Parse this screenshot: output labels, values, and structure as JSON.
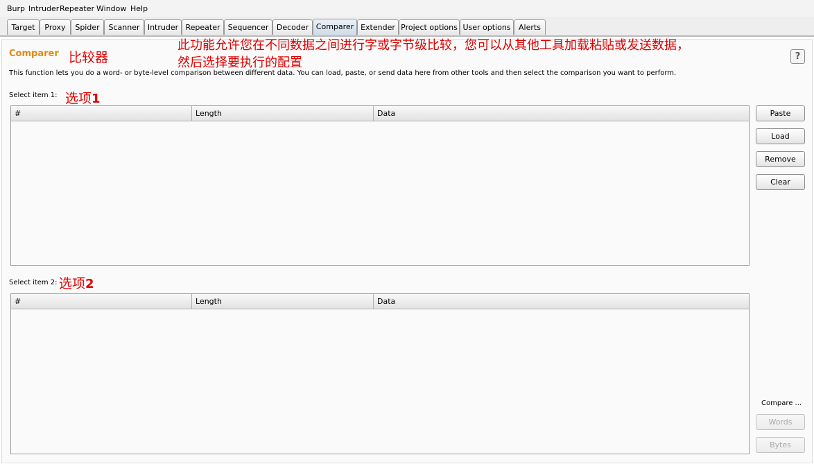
{
  "menu": [
    "Burp",
    "Intruder",
    "Repeater",
    "Window",
    "Help"
  ],
  "tabs": [
    "Target",
    "Proxy",
    "Spider",
    "Scanner",
    "Intruder",
    "Repeater",
    "Sequencer",
    "Decoder",
    "Comparer",
    "Extender",
    "Project options",
    "User options",
    "Alerts"
  ],
  "active_tab": "Comparer",
  "page": {
    "title": "Comparer",
    "title_cn": "比较器",
    "note_cn_line1": "此功能允许您在不同数据之间进行字或字节级比较，您可以从其他工具加载粘贴或发送数据，",
    "note_cn_line2": "然后选择要执行的配置",
    "description": "This function lets you do a word- or byte-level comparison between different data. You can load, paste, or send data here from other tools and then select the comparison you want to perform.",
    "help_label": "?"
  },
  "item1": {
    "label": "Select item 1:",
    "label_cn": "选项",
    "label_num": "1",
    "columns": [
      "#",
      "Length",
      "Data"
    ]
  },
  "item2": {
    "label": "Select item 2:",
    "label_cn": "选项",
    "label_num": "2",
    "columns": [
      "#",
      "Length",
      "Data"
    ]
  },
  "buttons": {
    "paste": "Paste",
    "load": "Load",
    "remove": "Remove",
    "clear": "Clear"
  },
  "compare": {
    "label": "Compare ...",
    "words": "Words",
    "bytes": "Bytes"
  }
}
